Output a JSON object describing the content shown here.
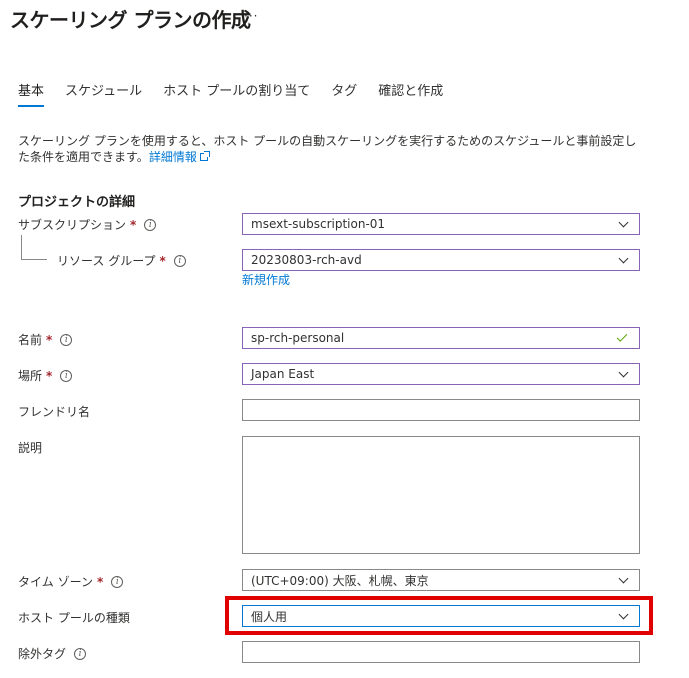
{
  "page": {
    "title": "スケーリング プランの作成",
    "more_label": "···"
  },
  "tabs": [
    {
      "label": "基本",
      "active": true
    },
    {
      "label": "スケジュール"
    },
    {
      "label": "ホスト プールの割り当て"
    },
    {
      "label": "タグ"
    },
    {
      "label": "確認と作成"
    }
  ],
  "intro": {
    "text": "スケーリング プランを使用すると、ホスト プールの自動スケーリングを実行するためのスケジュールと事前設定した条件を適用できます。",
    "link": "詳細情報"
  },
  "section": {
    "project_details": "プロジェクトの詳細"
  },
  "form": {
    "subscription": {
      "label": "サブスクリプション",
      "required": "*",
      "value": "msext-subscription-01"
    },
    "resource_group": {
      "label": "リソース グループ",
      "required": "*",
      "value": "20230803-rch-avd",
      "create_new": "新規作成"
    },
    "name": {
      "label": "名前",
      "required": "*",
      "value": "sp-rch-personal"
    },
    "location": {
      "label": "場所",
      "required": "*",
      "value": "Japan East"
    },
    "friendly_name": {
      "label": "フレンドリ名",
      "value": ""
    },
    "description": {
      "label": "説明",
      "value": ""
    },
    "timezone": {
      "label": "タイム ゾーン",
      "required": "*",
      "value": "(UTC+09:00) 大阪、札幌、東京"
    },
    "host_pool_type": {
      "label": "ホスト プールの種類",
      "value": "個人用"
    },
    "exclusion_tag": {
      "label": "除外タグ",
      "value": ""
    }
  },
  "icons": {
    "info": "i"
  },
  "colors": {
    "accent": "#0078d4",
    "required": "#a4262c",
    "valid_border": "#8764b8",
    "highlight": "#e00000"
  }
}
